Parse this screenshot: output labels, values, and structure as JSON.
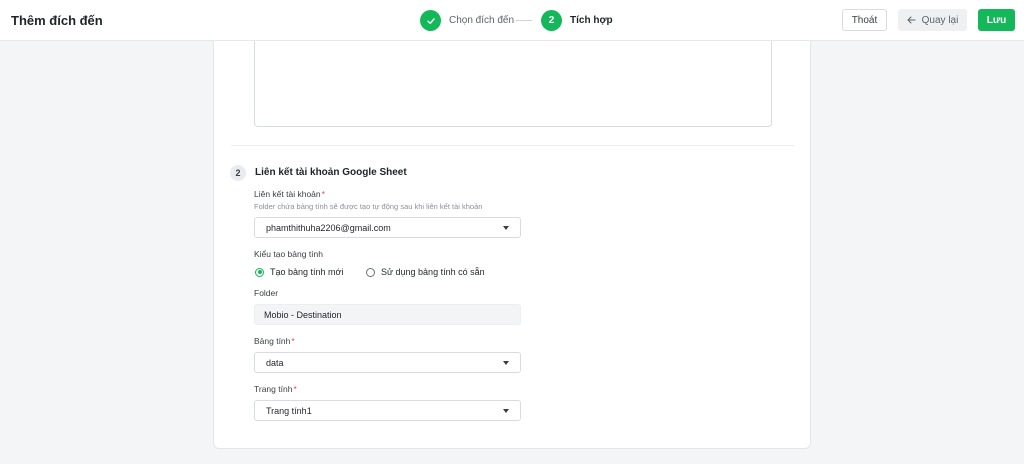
{
  "header": {
    "title": "Thêm đích đến",
    "steps": [
      {
        "icon": "check-icon",
        "label": "Chọn đích đến",
        "state": "done"
      },
      {
        "number": "2",
        "label": "Tích hợp",
        "state": "active"
      }
    ],
    "buttons": {
      "exit": "Thoát",
      "back": "Quay lại",
      "save": "Lưu"
    }
  },
  "section": {
    "number": "2",
    "title": "Liên kết tài khoản Google Sheet"
  },
  "fields": {
    "account": {
      "label": "Liên kết tài khoản",
      "required_mark": "*",
      "hint": "Folder chứa bảng tính sẽ được tạo tự động sau khi liên kết tài khoản",
      "value": "phamthithuha2206@gmail.com"
    },
    "creation_type": {
      "label": "Kiểu tạo bảng tính",
      "options": [
        {
          "label": "Tạo bảng tính mới",
          "checked": true
        },
        {
          "label": "Sử dụng bảng tính có sẵn",
          "checked": false
        }
      ]
    },
    "folder": {
      "label": "Folder",
      "value": "Mobio - Destination"
    },
    "spreadsheet": {
      "label": "Bảng tính",
      "required_mark": "*",
      "value": "data"
    },
    "sheet": {
      "label": "Trang tính",
      "required_mark": "*",
      "value": "Trang tính1"
    }
  },
  "colors": {
    "accent": "#14b85a",
    "required": "#e5484d",
    "background": "#f4f5f7"
  }
}
